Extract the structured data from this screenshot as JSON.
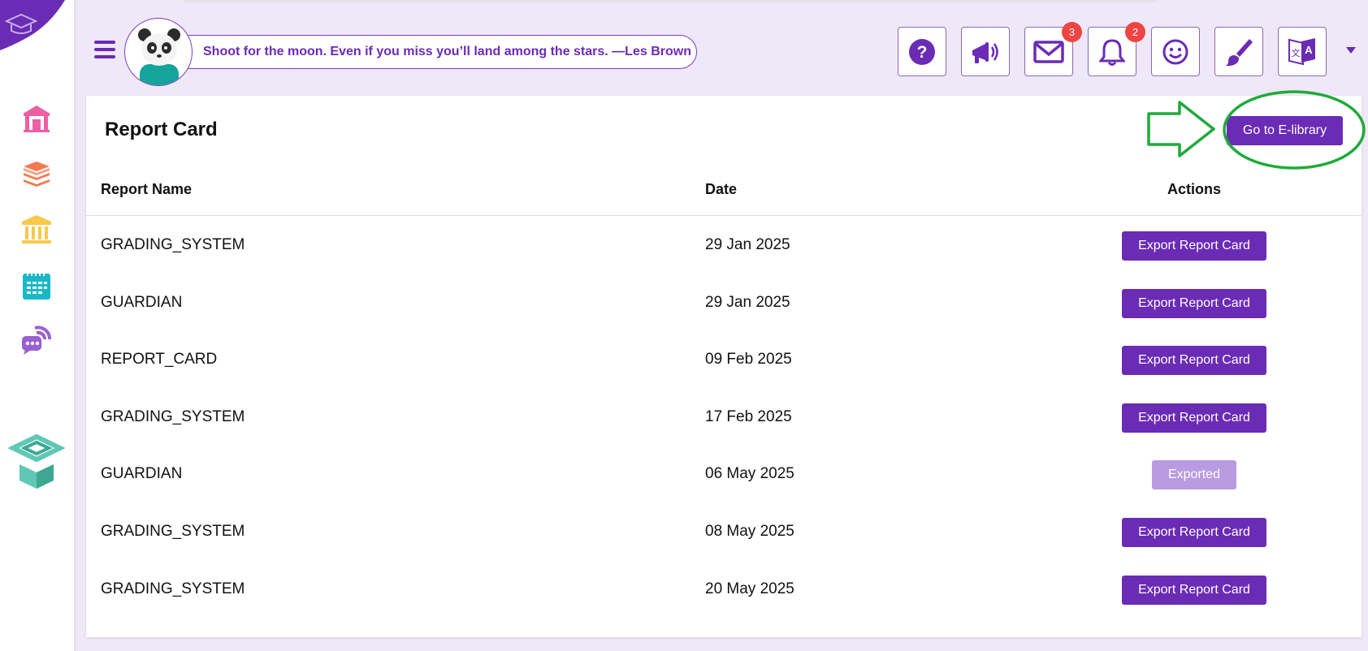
{
  "quote": "Shoot for the moon. Even if you miss you’ll land among the stars. —Les Brown",
  "toolbar": {
    "messages_badge": "3",
    "notifications_badge": "2"
  },
  "page": {
    "title": "Report Card",
    "elibrary_button": "Go to E-library"
  },
  "table": {
    "headers": {
      "name": "Report Name",
      "date": "Date",
      "actions": "Actions"
    },
    "rows": [
      {
        "name": "GRADING_SYSTEM",
        "date": "29 Jan 2025",
        "action": "Export Report Card"
      },
      {
        "name": "GUARDIAN",
        "date": "29 Jan 2025",
        "action": "Export Report Card"
      },
      {
        "name": "REPORT_CARD",
        "date": "09 Feb 2025",
        "action": "Export Report Card"
      },
      {
        "name": "GRADING_SYSTEM",
        "date": "17 Feb 2025",
        "action": "Export Report Card"
      },
      {
        "name": "GUARDIAN",
        "date": "06 May 2025",
        "action": "Exported"
      },
      {
        "name": "GRADING_SYSTEM",
        "date": "08 May 2025",
        "action": "Export Report Card"
      },
      {
        "name": "GRADING_SYSTEM",
        "date": "20 May 2025",
        "action": "Export Report Card"
      }
    ]
  },
  "colors": {
    "brand_purple": "#6a2bb5",
    "exported_disabled": "#b99be2",
    "badge_red": "#ef4444",
    "annotation_green": "#1faa3a"
  },
  "icons": {
    "sidebar": [
      "school-icon",
      "books-icon",
      "institution-icon",
      "calendar-icon",
      "chat-icon"
    ],
    "toolbar": [
      "help-icon",
      "announcement-icon",
      "mail-icon",
      "bell-icon",
      "smiley-icon",
      "paintbrush-icon",
      "translate-icon"
    ]
  }
}
